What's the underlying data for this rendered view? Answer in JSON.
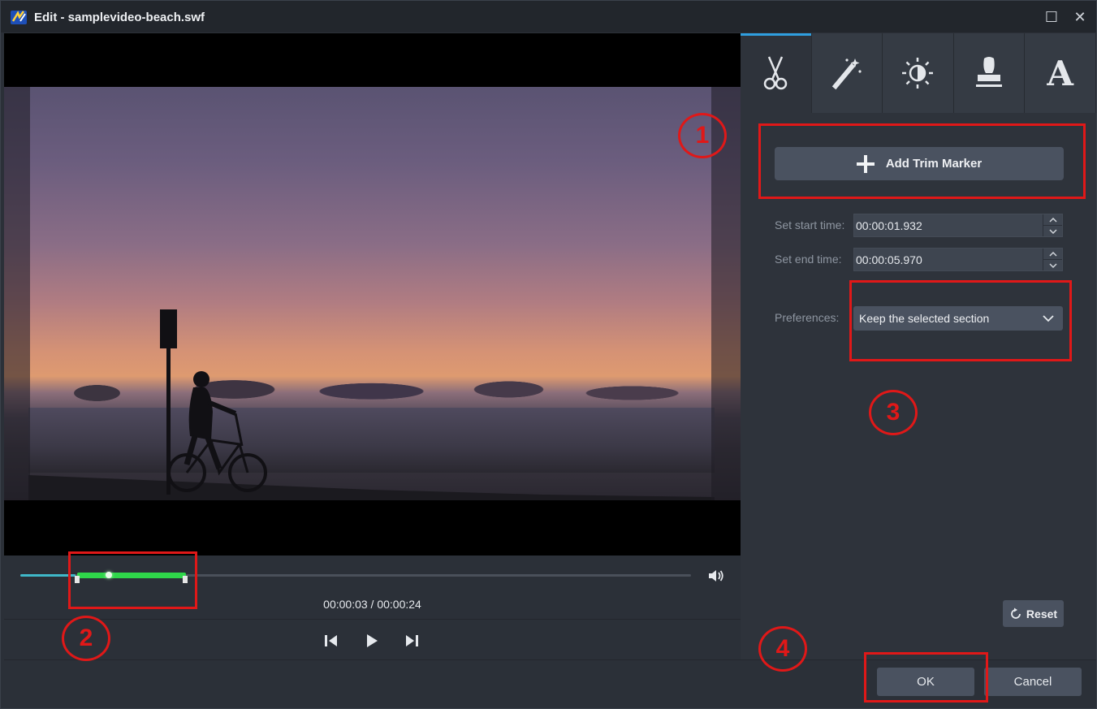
{
  "window": {
    "title": "Edit - samplevideo-beach.swf",
    "maximize_glyph": "☐",
    "close_glyph": "✕"
  },
  "tabs": [
    {
      "icon": "scissors-icon",
      "active": true
    },
    {
      "icon": "magic-wand-icon",
      "active": false
    },
    {
      "icon": "brightness-icon",
      "active": false
    },
    {
      "icon": "stamp-icon",
      "active": false
    },
    {
      "icon": "text-icon",
      "letter": "A",
      "active": false
    }
  ],
  "trim": {
    "add_marker_label": "Add Trim Marker",
    "start_label": "Set start time:",
    "start_value": "00:00:01.932",
    "end_label": "Set end time:",
    "end_value": "00:00:05.970",
    "preferences_label": "Preferences:",
    "preferences_value": "Keep the selected section",
    "reset_label": "Reset"
  },
  "player": {
    "timecode": "00:00:03 / 00:00:24",
    "current_seconds": 3,
    "total_seconds": 24,
    "trim_start_seconds": 1.932,
    "trim_end_seconds": 5.97
  },
  "dialog": {
    "ok_label": "OK",
    "cancel_label": "Cancel"
  },
  "annotations": [
    "1",
    "2",
    "3",
    "4"
  ],
  "colors": {
    "accent": "#2f9fe0",
    "selection": "#2fd64a",
    "annotation": "#e01818"
  }
}
